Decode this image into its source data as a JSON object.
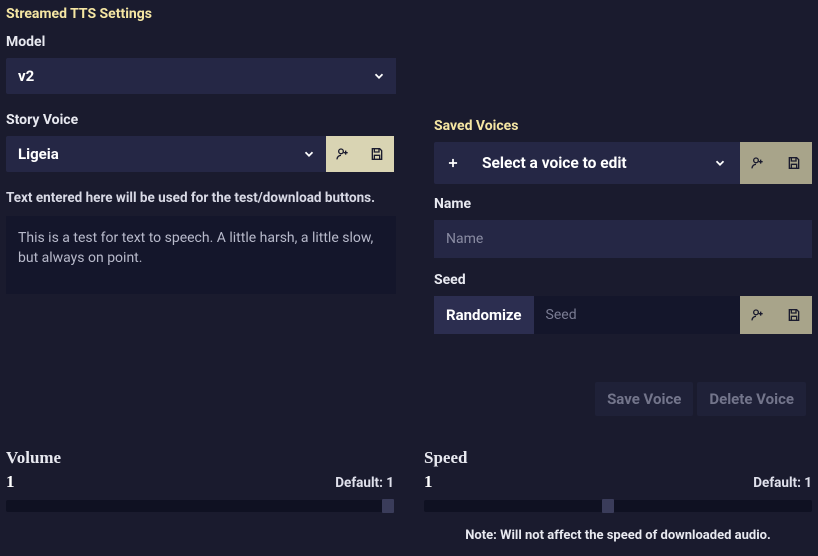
{
  "title": "Streamed TTS Settings",
  "model": {
    "label": "Model",
    "value": "v2"
  },
  "story_voice": {
    "label": "Story Voice",
    "value": "Ligeia"
  },
  "test_text": {
    "help": "Text entered here will be used for the test/download buttons.",
    "value": "This is a test for text to speech. A little harsh, a little slow, but always on point."
  },
  "saved_voices": {
    "label": "Saved Voices",
    "select_placeholder": "Select a voice to edit",
    "name": {
      "label": "Name",
      "placeholder": "Name"
    },
    "seed": {
      "label": "Seed",
      "randomize": "Randomize",
      "placeholder": "Seed"
    },
    "save_label": "Save Voice",
    "delete_label": "Delete Voice"
  },
  "volume": {
    "label": "Volume",
    "value": "1",
    "default": "Default: 1",
    "pos_pct": 97
  },
  "speed": {
    "label": "Speed",
    "value": "1",
    "default": "Default: 1",
    "pos_pct": 46,
    "note": "Note: Will not affect the speed of downloaded audio."
  }
}
